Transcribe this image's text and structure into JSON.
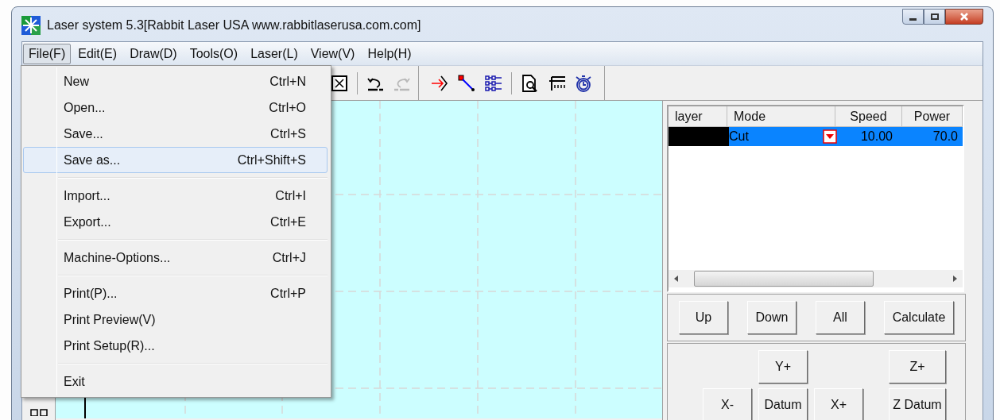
{
  "window": {
    "title": "Laser system 5.3[Rabbit Laser USA www.rabbitlaserusa.com.com]"
  },
  "menu_bar": [
    {
      "label": "File(F)",
      "selected": true
    },
    {
      "label": "Edit(E)",
      "selected": false
    },
    {
      "label": "Draw(D)",
      "selected": false
    },
    {
      "label": "Tools(O)",
      "selected": false
    },
    {
      "label": "Laser(L)",
      "selected": false
    },
    {
      "label": "View(V)",
      "selected": false
    },
    {
      "label": "Help(H)",
      "selected": false
    }
  ],
  "file_menu": {
    "groups": [
      [
        {
          "label": "New",
          "shortcut": "Ctrl+N",
          "selected": false
        },
        {
          "label": "Open...",
          "shortcut": "Ctrl+O",
          "selected": false
        },
        {
          "label": "Save...",
          "shortcut": "Ctrl+S",
          "selected": false
        },
        {
          "label": "Save as...",
          "shortcut": "Ctrl+Shift+S",
          "selected": true
        }
      ],
      [
        {
          "label": "Import...",
          "shortcut": "Ctrl+I",
          "selected": false
        },
        {
          "label": "Export...",
          "shortcut": "Ctrl+E",
          "selected": false
        }
      ],
      [
        {
          "label": "Machine-Options...",
          "shortcut": "Ctrl+J",
          "selected": false
        }
      ],
      [
        {
          "label": "Print(P)...",
          "shortcut": "Ctrl+P",
          "selected": false
        },
        {
          "label": "Print Preview(V)",
          "selected": false
        },
        {
          "label": "Print Setup(R)...",
          "selected": false
        }
      ],
      [
        {
          "label": "Exit",
          "selected": false
        }
      ]
    ]
  },
  "toolbar": [
    {
      "kind": "fit",
      "disabled": false
    },
    {
      "kind": "undo",
      "disabled": false
    },
    {
      "kind": "redo",
      "disabled": true
    },
    {
      "kind": "lead",
      "disabled": false
    },
    {
      "kind": "node",
      "disabled": false
    },
    {
      "kind": "array",
      "disabled": false
    },
    {
      "kind": "preview",
      "disabled": false
    },
    {
      "kind": "ruler",
      "disabled": false
    },
    {
      "kind": "timer",
      "disabled": false
    }
  ],
  "layer_table": {
    "columns": [
      "layer",
      "Mode",
      "Speed",
      "Power"
    ],
    "rows": [
      {
        "color": "#000000",
        "mode": "Cut",
        "speed": "10.00",
        "power": "70.0",
        "selected": true
      }
    ]
  },
  "layer_buttons": [
    "Up",
    "Down",
    "All",
    "Calculate"
  ],
  "jog_top": [
    "Y+",
    "Z+"
  ],
  "jog_bottom": [
    "X-",
    "Datum",
    "X+",
    "Z Datum"
  ]
}
